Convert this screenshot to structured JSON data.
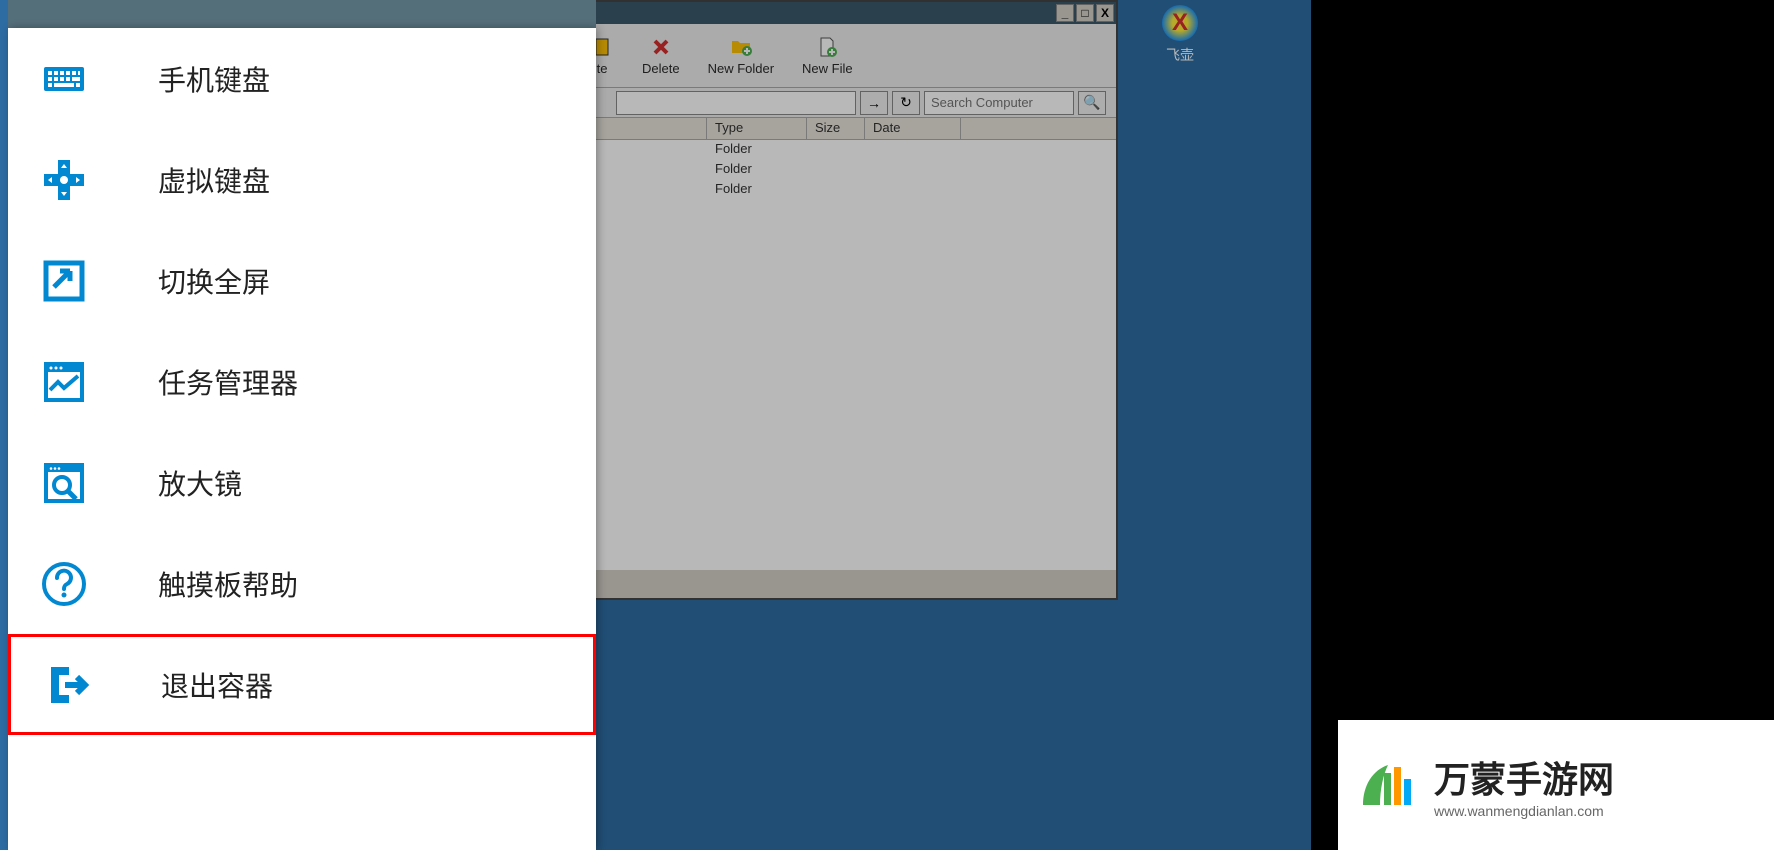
{
  "desktop": {
    "icon": {
      "label": "飞壶",
      "glyph": "X"
    }
  },
  "file_manager": {
    "toolbar": {
      "paste_partial": "te",
      "delete": "Delete",
      "new_folder": "New Folder",
      "new_file": "New File"
    },
    "addrbar": {
      "go": "→",
      "refresh": "C",
      "search_placeholder": "Search Computer",
      "search_icon": "🔍"
    },
    "columns": {
      "type": "Type",
      "size": "Size",
      "date": "Date"
    },
    "rows": [
      {
        "type": "Folder"
      },
      {
        "type": "Folder"
      },
      {
        "type": "Folder"
      }
    ],
    "window_controls": {
      "minimize": "_",
      "maximize": "□",
      "close": "X"
    }
  },
  "menu": {
    "items": [
      {
        "id": "phone-keyboard",
        "label": "手机键盘"
      },
      {
        "id": "virtual-keyboard",
        "label": "虚拟键盘"
      },
      {
        "id": "toggle-fullscreen",
        "label": "切换全屏"
      },
      {
        "id": "task-manager",
        "label": "任务管理器"
      },
      {
        "id": "magnifier",
        "label": "放大镜"
      },
      {
        "id": "touchpad-help",
        "label": "触摸板帮助"
      },
      {
        "id": "exit-container",
        "label": "退出容器",
        "highlighted": true
      }
    ]
  },
  "watermark": {
    "title": "万蒙手游网",
    "url": "www.wanmengdianlan.com"
  },
  "colors": {
    "accent": "#0288d1",
    "highlight_border": "#ff0000",
    "desktop_bg": "#2d6ca2"
  }
}
